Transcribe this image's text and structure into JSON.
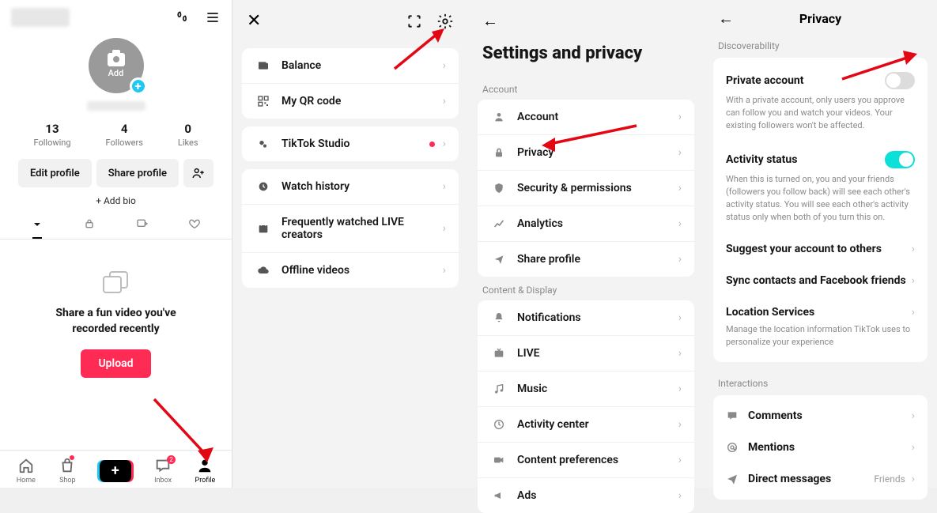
{
  "panel1": {
    "avatar_text": "Add",
    "stats": [
      {
        "num": "13",
        "label": "Following"
      },
      {
        "num": "4",
        "label": "Followers"
      },
      {
        "num": "0",
        "label": "Likes"
      }
    ],
    "edit_profile": "Edit profile",
    "share_profile": "Share profile",
    "add_bio": "+ Add bio",
    "share_text": "Share a fun video you've recorded recently",
    "upload": "Upload",
    "nav": {
      "home": "Home",
      "shop": "Shop",
      "inbox": "Inbox",
      "profile": "Profile",
      "inbox_badge": "2"
    }
  },
  "panel2": {
    "rows1": [
      {
        "label": "Balance"
      },
      {
        "label": "My QR code"
      }
    ],
    "studio": "TikTok Studio",
    "rows3": [
      {
        "label": "Watch history"
      },
      {
        "label": "Frequently watched LIVE creators"
      },
      {
        "label": "Offline videos"
      }
    ]
  },
  "panel3": {
    "title": "Settings and privacy",
    "account_label": "Account",
    "account_rows": [
      {
        "label": "Account"
      },
      {
        "label": "Privacy"
      },
      {
        "label": "Security & permissions"
      },
      {
        "label": "Analytics"
      },
      {
        "label": "Share profile"
      }
    ],
    "content_label": "Content & Display",
    "content_rows": [
      {
        "label": "Notifications"
      },
      {
        "label": "LIVE"
      },
      {
        "label": "Music"
      },
      {
        "label": "Activity center"
      },
      {
        "label": "Content preferences"
      },
      {
        "label": "Ads"
      }
    ]
  },
  "panel4": {
    "title": "Privacy",
    "disc_label": "Discoverability",
    "private_title": "Private account",
    "private_desc": "With a private account, only users you approve can follow you and watch your videos. Your existing followers won't be affected.",
    "activity_title": "Activity status",
    "activity_desc": "When this is turned on, you and your friends (followers you follow back) will see each other's activity status. You will see each other's activity status only when both of you turn this on.",
    "suggest": "Suggest your account to others",
    "sync": "Sync contacts and Facebook friends",
    "location_title": "Location Services",
    "location_desc": "Manage the location information TikTok uses to personalize your experience",
    "interactions_label": "Interactions",
    "comments": "Comments",
    "mentions": "Mentions",
    "dm": "Direct messages",
    "dm_value": "Friends"
  }
}
